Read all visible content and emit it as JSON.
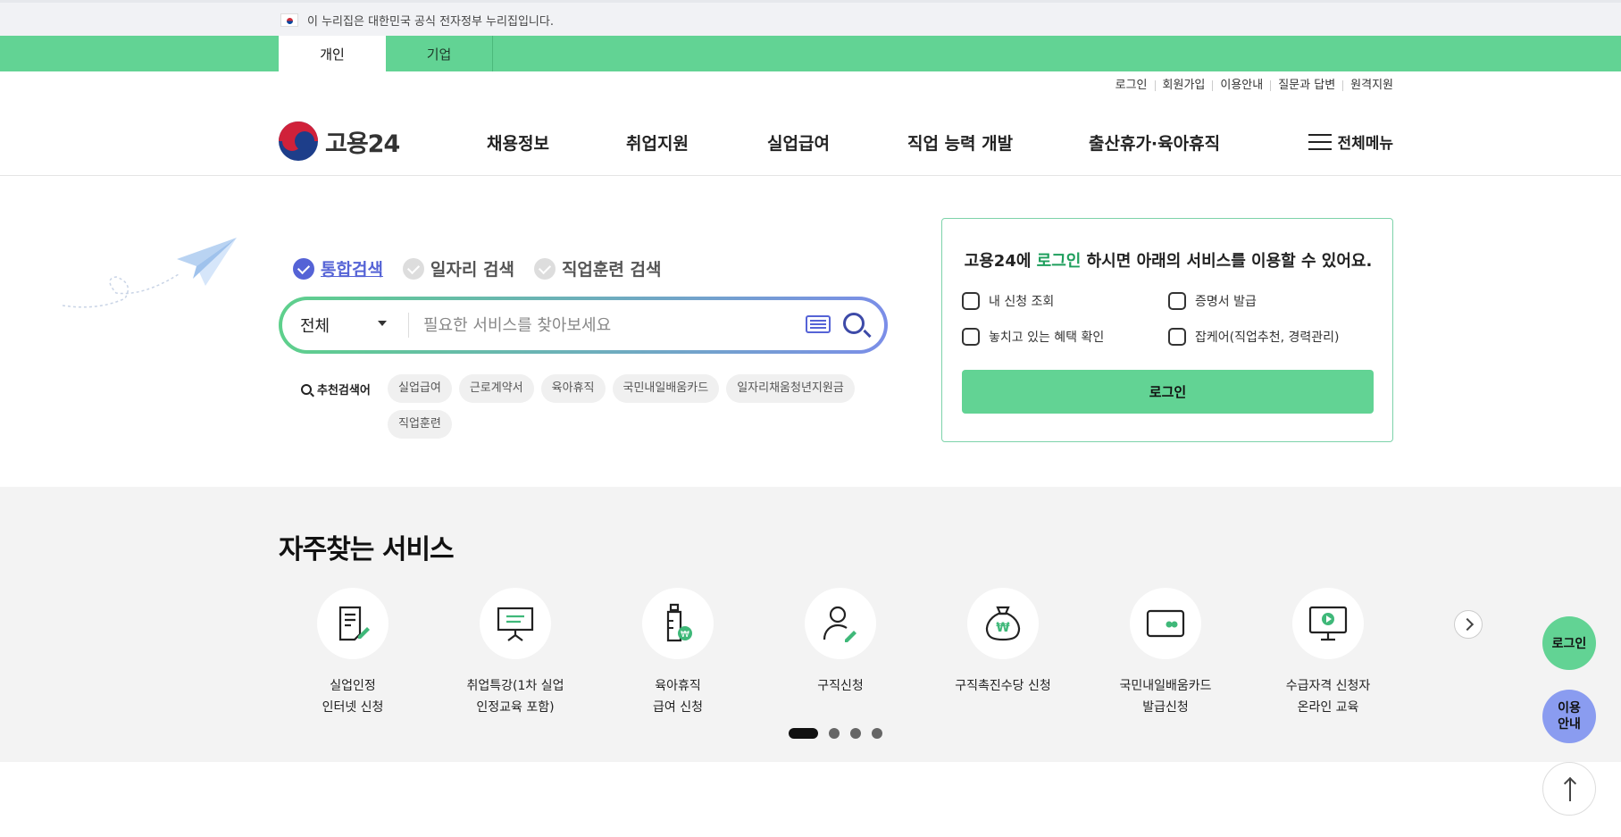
{
  "gov_banner": {
    "text": "이 누리집은 대한민국 공식 전자정부 누리집입니다."
  },
  "audience_tabs": [
    {
      "label": "개인",
      "active": true
    },
    {
      "label": "기업",
      "active": false
    }
  ],
  "utility_links": [
    "로그인",
    "회원가입",
    "이용안내",
    "질문과 답변",
    "원격지원"
  ],
  "header": {
    "logo_text": "고용24",
    "nav": [
      "채용정보",
      "취업지원",
      "실업급여",
      "직업 능력 개발",
      "출산휴가·육아휴직"
    ],
    "menu_all": "전체메뉴"
  },
  "search": {
    "tabs": [
      {
        "label": "통합검색",
        "active": true
      },
      {
        "label": "일자리 검색",
        "active": false
      },
      {
        "label": "직업훈련 검색",
        "active": false
      }
    ],
    "scope": "전체",
    "placeholder": "필요한 서비스를 찾아보세요",
    "recommend_label": "추천검색어",
    "keywords": [
      "실업급여",
      "근로계약서",
      "육아휴직",
      "국민내일배움카드",
      "일자리채움청년지원금",
      "직업훈련"
    ]
  },
  "login_card": {
    "title_pre": "고용24에 ",
    "title_hl": "로그인",
    "title_post": " 하시면 아래의 서비스를 이용할 수 있어요.",
    "items": [
      "내 신청 조회",
      "증명서 발급",
      "놓치고 있는 혜택 확인",
      "잡케어(직업추천, 경력관리)"
    ],
    "button": "로그인"
  },
  "frequent": {
    "title": "자주찾는 서비스",
    "services": [
      {
        "line1": "실업인정",
        "line2": "인터넷 신청",
        "icon": "document-pen-icon"
      },
      {
        "line1": "취업특강(1차 실업",
        "line2": "인정교육 포함)",
        "icon": "presentation-board-icon"
      },
      {
        "line1": "육아휴직",
        "line2": "급여 신청",
        "icon": "baby-bottle-icon"
      },
      {
        "line1": "구직신청",
        "line2": "",
        "icon": "person-pen-icon"
      },
      {
        "line1": "구직촉진수당 신청",
        "line2": "",
        "icon": "money-bag-icon"
      },
      {
        "line1": "국민내일배움카드",
        "line2": "발급신청",
        "icon": "card-icon"
      },
      {
        "line1": "수급자격 신청자",
        "line2": "온라인 교육",
        "icon": "monitor-play-icon"
      }
    ]
  },
  "floating": {
    "login": "로그인",
    "guide1": "이용",
    "guide2": "안내"
  },
  "colors": {
    "brand_green": "#62d394",
    "accent_blue": "#5563d6"
  }
}
